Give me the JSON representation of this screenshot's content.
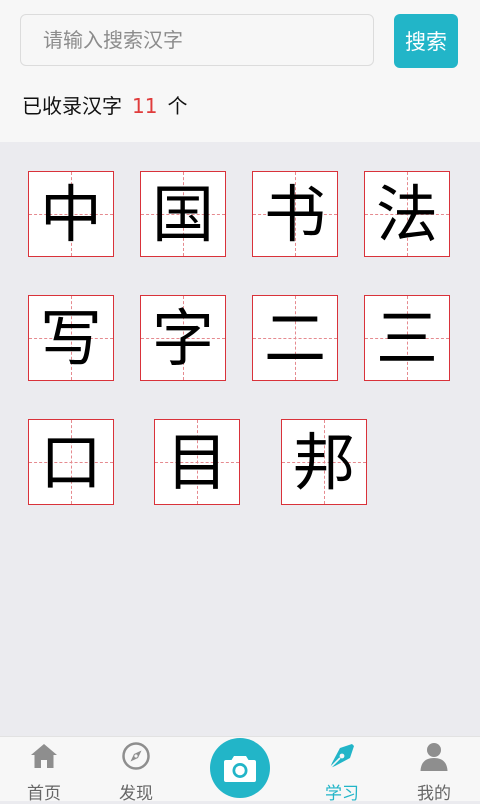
{
  "search": {
    "placeholder": "请输入搜索汉字",
    "button_label": "搜索"
  },
  "summary": {
    "prefix": "已收录汉字",
    "count": "11",
    "suffix": "个"
  },
  "characters": [
    "中",
    "国",
    "书",
    "法",
    "写",
    "字",
    "二",
    "三",
    "口",
    "目",
    "邦"
  ],
  "nav": {
    "items": [
      {
        "label": "首页",
        "icon": "home-icon"
      },
      {
        "label": "发现",
        "icon": "compass-icon"
      },
      {
        "label": "",
        "icon": "camera-icon"
      },
      {
        "label": "学习",
        "icon": "pen-nib-icon"
      },
      {
        "label": "我的",
        "icon": "user-icon"
      }
    ],
    "active_index": 3
  },
  "colors": {
    "accent": "#22b5c8",
    "grid_border": "#d9323a",
    "grid_dash": "#e58a8f",
    "count_highlight": "#e03c3c",
    "nav_inactive": "#8e8e8e"
  }
}
